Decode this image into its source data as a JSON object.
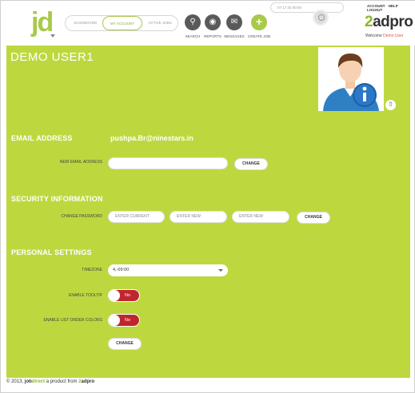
{
  "header": {
    "logo_text": "jd",
    "nav_tabs": [
      "DASHBOARD",
      "MY ACCOUNT",
      "ACTIVE JOBS"
    ],
    "actions": [
      {
        "label": "SEARCH",
        "icon": "search-icon"
      },
      {
        "label": "REPORTS",
        "icon": "reports-icon"
      },
      {
        "label": "MESSAGES",
        "icon": "messages-icon"
      },
      {
        "label": "CREATE JOB",
        "icon": "plus-icon"
      }
    ],
    "time_text": "07:17:30  00:00",
    "top_links": [
      "ACCOUNT",
      "HELP",
      "LOGOUT"
    ],
    "brand_num": "2",
    "brand_text": "adpro",
    "welcome_label": "Welcome",
    "welcome_user": "Demo User"
  },
  "profile": {
    "name": "DEMO USER1"
  },
  "email": {
    "section_title": "EMAIL ADDRESS",
    "current_email": "pushpa.Br@ninestars.in",
    "new_label": "NEW EMAIL ADDRESS",
    "new_value": "",
    "change_label": "CHANGE"
  },
  "security": {
    "section_title": "SECURITY INFORMATION",
    "change_label": "CHANGE PASSWORD",
    "current_placeholder": "ENTER CURRENT",
    "new_placeholder": "ENTER NEW",
    "confirm_placeholder": "ENTER NEW",
    "button_label": "CHANGE"
  },
  "personal": {
    "section_title": "PERSONAL SETTINGS",
    "timezone_label": "TIMEZONE",
    "timezone_value": "4,-09:00",
    "tooltip_label": "ENABLE TOOLTIP",
    "tooltip_state": "No",
    "colors_label": "ENABLE LIST ORDER COLORS",
    "colors_state": "No",
    "button_label": "CHANGE"
  },
  "footer": {
    "copyright": "© 2013,",
    "jd_a": "job",
    "jd_b": "direct",
    "middle": "a product from",
    "brand_num": "2",
    "brand_text": "adpro"
  },
  "colors": {
    "panel": "#bdd83f",
    "accent": "#a9c94a",
    "toggle_off": "#c0262d"
  }
}
